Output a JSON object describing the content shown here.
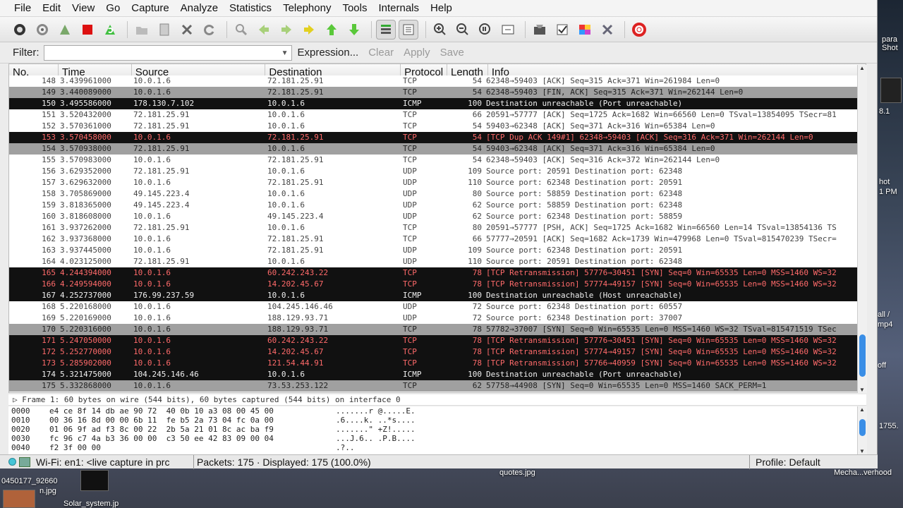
{
  "menu": [
    "File",
    "Edit",
    "View",
    "Go",
    "Capture",
    "Analyze",
    "Statistics",
    "Telephony",
    "Tools",
    "Internals",
    "Help"
  ],
  "toolbar_icons": [
    "interface-list-icon",
    "capture-options-icon",
    "start-capture-icon",
    "stop-capture-icon",
    "restart-capture-icon",
    "open-file-icon",
    "save-file-icon",
    "close-file-icon",
    "reload-icon",
    "find-packet-icon",
    "back-icon",
    "forward-icon",
    "go-to-packet-icon",
    "first-packet-icon",
    "last-packet-icon",
    "colorize-icon",
    "auto-scroll-icon",
    "zoom-in-icon",
    "zoom-out-icon",
    "normal-size-icon",
    "resize-columns-icon",
    "capture-filters-icon",
    "display-filters-icon",
    "coloring-rules-icon",
    "preferences-icon",
    "help-icon"
  ],
  "filter": {
    "label": "Filter:",
    "value": "",
    "expression": "Expression...",
    "clear": "Clear",
    "apply": "Apply",
    "save": "Save"
  },
  "columns": [
    "No.",
    "Time",
    "Source",
    "Destination",
    "Protocol",
    "Length",
    "Info"
  ],
  "packets": [
    {
      "no": "148",
      "time": "3.439961000",
      "src": "10.0.1.6",
      "dst": "72.181.25.91",
      "proto": "TCP",
      "len": "54",
      "info": "62348→59403 [ACK] Seq=315 Ack=371 Win=261984 Len=0",
      "style": "normal"
    },
    {
      "no": "149",
      "time": "3.440089000",
      "src": "10.0.1.6",
      "dst": "72.181.25.91",
      "proto": "TCP",
      "len": "54",
      "info": "62348→59403 [FIN, ACK] Seq=315 Ack=371 Win=262144 Len=0",
      "style": "gray"
    },
    {
      "no": "150",
      "time": "3.495586000",
      "src": "178.130.7.102",
      "dst": "10.0.1.6",
      "proto": "ICMP",
      "len": "100",
      "info": "Destination unreachable (Port unreachable)",
      "style": "black"
    },
    {
      "no": "151",
      "time": "3.520432000",
      "src": "72.181.25.91",
      "dst": "10.0.1.6",
      "proto": "TCP",
      "len": "66",
      "info": "20591→57777 [ACK] Seq=1725 Ack=1682 Win=66560 Len=0 TSval=13854095 TSecr=81",
      "style": "normal"
    },
    {
      "no": "152",
      "time": "3.570361000",
      "src": "72.181.25.91",
      "dst": "10.0.1.6",
      "proto": "TCP",
      "len": "54",
      "info": "59403→62348 [ACK] Seq=371 Ack=316 Win=65384 Len=0",
      "style": "normal"
    },
    {
      "no": "153",
      "time": "3.570458000",
      "src": "10.0.1.6",
      "dst": "72.181.25.91",
      "proto": "TCP",
      "len": "54",
      "info": "[TCP Dup ACK 149#1] 62348→59403 [ACK] Seq=316 Ack=371 Win=262144 Len=0",
      "style": "black-red"
    },
    {
      "no": "154",
      "time": "3.570938000",
      "src": "72.181.25.91",
      "dst": "10.0.1.6",
      "proto": "TCP",
      "len": "54",
      "info": "59403→62348 [ACK] Seq=371 Ack=316 Win=65384 Len=0",
      "style": "gray"
    },
    {
      "no": "155",
      "time": "3.570983000",
      "src": "10.0.1.6",
      "dst": "72.181.25.91",
      "proto": "TCP",
      "len": "54",
      "info": "62348→59403 [ACK] Seq=316 Ack=372 Win=262144 Len=0",
      "style": "normal"
    },
    {
      "no": "156",
      "time": "3.629352000",
      "src": "72.181.25.91",
      "dst": "10.0.1.6",
      "proto": "UDP",
      "len": "109",
      "info": "Source port: 20591  Destination port: 62348",
      "style": "normal"
    },
    {
      "no": "157",
      "time": "3.629632000",
      "src": "10.0.1.6",
      "dst": "72.181.25.91",
      "proto": "UDP",
      "len": "110",
      "info": "Source port: 62348  Destination port: 20591",
      "style": "normal"
    },
    {
      "no": "158",
      "time": "3.705869000",
      "src": "49.145.223.4",
      "dst": "10.0.1.6",
      "proto": "UDP",
      "len": "80",
      "info": "Source port: 58859  Destination port: 62348",
      "style": "normal"
    },
    {
      "no": "159",
      "time": "3.818365000",
      "src": "49.145.223.4",
      "dst": "10.0.1.6",
      "proto": "UDP",
      "len": "62",
      "info": "Source port: 58859  Destination port: 62348",
      "style": "normal"
    },
    {
      "no": "160",
      "time": "3.818608000",
      "src": "10.0.1.6",
      "dst": "49.145.223.4",
      "proto": "UDP",
      "len": "62",
      "info": "Source port: 62348  Destination port: 58859",
      "style": "normal"
    },
    {
      "no": "161",
      "time": "3.937262000",
      "src": "72.181.25.91",
      "dst": "10.0.1.6",
      "proto": "TCP",
      "len": "80",
      "info": "20591→57777 [PSH, ACK] Seq=1725 Ack=1682 Win=66560 Len=14 TSval=13854136 TS",
      "style": "normal"
    },
    {
      "no": "162",
      "time": "3.937368000",
      "src": "10.0.1.6",
      "dst": "72.181.25.91",
      "proto": "TCP",
      "len": "66",
      "info": "57777→20591 [ACK] Seq=1682 Ack=1739 Win=479968 Len=0 TSval=815470239 TSecr=",
      "style": "normal"
    },
    {
      "no": "163",
      "time": "3.937445000",
      "src": "10.0.1.6",
      "dst": "72.181.25.91",
      "proto": "UDP",
      "len": "109",
      "info": "Source port: 62348  Destination port: 20591",
      "style": "normal"
    },
    {
      "no": "164",
      "time": "4.023125000",
      "src": "72.181.25.91",
      "dst": "10.0.1.6",
      "proto": "UDP",
      "len": "110",
      "info": "Source port: 20591  Destination port: 62348",
      "style": "normal"
    },
    {
      "no": "165",
      "time": "4.244394000",
      "src": "10.0.1.6",
      "dst": "60.242.243.22",
      "proto": "TCP",
      "len": "78",
      "info": "[TCP Retransmission] 57776→30451 [SYN] Seq=0 Win=65535 Len=0 MSS=1460 WS=32",
      "style": "black-red"
    },
    {
      "no": "166",
      "time": "4.249594000",
      "src": "10.0.1.6",
      "dst": "14.202.45.67",
      "proto": "TCP",
      "len": "78",
      "info": "[TCP Retransmission] 57774→49157 [SYN] Seq=0 Win=65535 Len=0 MSS=1460 WS=32",
      "style": "black-red"
    },
    {
      "no": "167",
      "time": "4.252737000",
      "src": "176.99.237.59",
      "dst": "10.0.1.6",
      "proto": "ICMP",
      "len": "100",
      "info": "Destination unreachable (Host unreachable)",
      "style": "black"
    },
    {
      "no": "168",
      "time": "5.220168000",
      "src": "10.0.1.6",
      "dst": "104.245.146.46",
      "proto": "UDP",
      "len": "72",
      "info": "Source port: 62348  Destination port: 60557",
      "style": "normal"
    },
    {
      "no": "169",
      "time": "5.220169000",
      "src": "10.0.1.6",
      "dst": "188.129.93.71",
      "proto": "UDP",
      "len": "72",
      "info": "Source port: 62348  Destination port: 37007",
      "style": "normal"
    },
    {
      "no": "170",
      "time": "5.220316000",
      "src": "10.0.1.6",
      "dst": "188.129.93.71",
      "proto": "TCP",
      "len": "78",
      "info": "57782→37007 [SYN] Seq=0 Win=65535 Len=0 MSS=1460 WS=32 TSval=815471519 TSec",
      "style": "gray"
    },
    {
      "no": "171",
      "time": "5.247050000",
      "src": "10.0.1.6",
      "dst": "60.242.243.22",
      "proto": "TCP",
      "len": "78",
      "info": "[TCP Retransmission] 57776→30451 [SYN] Seq=0 Win=65535 Len=0 MSS=1460 WS=32",
      "style": "black-red"
    },
    {
      "no": "172",
      "time": "5.252770000",
      "src": "10.0.1.6",
      "dst": "14.202.45.67",
      "proto": "TCP",
      "len": "78",
      "info": "[TCP Retransmission] 57774→49157 [SYN] Seq=0 Win=65535 Len=0 MSS=1460 WS=32",
      "style": "black-red"
    },
    {
      "no": "173",
      "time": "5.285902000",
      "src": "10.0.1.6",
      "dst": "121.54.44.91",
      "proto": "TCP",
      "len": "78",
      "info": "[TCP Retransmission] 57766→40959 [SYN] Seq=0 Win=65535 Len=0 MSS=1460 WS=32",
      "style": "black-red"
    },
    {
      "no": "174",
      "time": "5.321475000",
      "src": "104.245.146.46",
      "dst": "10.0.1.6",
      "proto": "ICMP",
      "len": "100",
      "info": "Destination unreachable (Port unreachable)",
      "style": "black"
    },
    {
      "no": "175",
      "time": "5.332868000",
      "src": "10.0.1.6",
      "dst": "73.53.253.122",
      "proto": "TCP",
      "len": "62",
      "info": "57758→44908 [SYN] Seq=0 Win=65535 Len=0 MSS=1460 SACK_PERM=1",
      "style": "gray"
    }
  ],
  "detail_line": "▷ Frame 1: 60 bytes on wire (544 bits), 60 bytes captured (544 bits) on interface 0",
  "bytes": [
    {
      "off": "0000",
      "hex": "e4 ce 8f 14 db ae 90 72  40 0b 10 a3 08 00 45 00",
      "ascii": ".......r @.....E."
    },
    {
      "off": "0010",
      "hex": "00 36 16 8d 00 00 6b 11  fe b5 2a 73 04 fc 0a 00",
      "ascii": ".6....k. ..*s...."
    },
    {
      "off": "0020",
      "hex": "01 06 9f ad f3 8c 00 22  2b 5a 21 01 8c ac ba f9",
      "ascii": ".......\" +Z!....."
    },
    {
      "off": "0030",
      "hex": "fc 96 c7 4a b3 36 00 00  c3 50 ee 42 83 09 00 04",
      "ascii": "...J.6.. .P.B...."
    },
    {
      "off": "0040",
      "hex": "f2 3f 00 00",
      "ascii": ".?.."
    }
  ],
  "status": {
    "interface": "Wi-Fi: en1: <live capture in prc",
    "packets": "Packets: 175 · Displayed: 175 (100.0%)",
    "profile": "Profile: Default"
  },
  "desktop": {
    "labels": [
      "0450177_92660",
      "n.jpg",
      "Solar_system.jp",
      "quotes.jpg",
      "Mecha...verhood",
      "1755.",
      "para",
      "Shot",
      "8.1",
      "hot",
      "1 PM",
      "all /",
      "mp4",
      "off"
    ]
  }
}
